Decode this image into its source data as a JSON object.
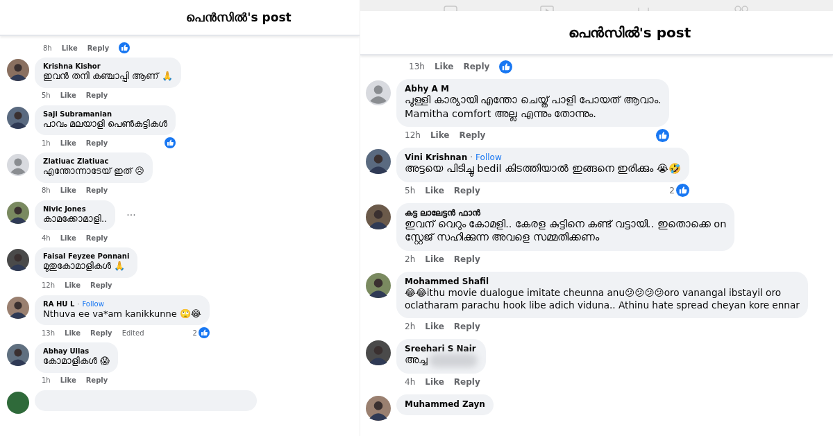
{
  "panels": [
    {
      "title": "പെൻസിൽ's post",
      "top_meta": {
        "time": "8h",
        "like": "Like",
        "reply": "Reply",
        "liked": true
      },
      "comments": [
        {
          "default_avatar": false,
          "name": "Krishna Kishor",
          "lines": [
            "ഇവൻ തനി കഞ്ചാപ്പി ആണ് 🙏"
          ],
          "time": "5h",
          "like": "Like",
          "reply": "Reply",
          "liked": false
        },
        {
          "default_avatar": false,
          "name": "Saji Subramanian",
          "lines": [
            "പാവം മലയാളി പെൺകുട്ടികൾ"
          ],
          "time": "1h",
          "like": "Like",
          "reply": "Reply",
          "liked": true
        },
        {
          "default_avatar": true,
          "name": "Zlatiuac Zlatiuac",
          "lines": [
            "എന്തോന്നാടേയ് ഇത് 😥"
          ],
          "time": "8h",
          "like": "Like",
          "reply": "Reply",
          "liked": false
        },
        {
          "default_avatar": false,
          "name": "Nivic Jones",
          "lines": [
            "കാമക്കോമാളി.."
          ],
          "more": "···",
          "time": "4h",
          "like": "Like",
          "reply": "Reply",
          "liked": false
        },
        {
          "default_avatar": false,
          "name": "Faisal Feyzee Ponnani",
          "lines": [
            "മുതുകോമാളികൾ 🙏"
          ],
          "time": "12h",
          "like": "Like",
          "reply": "Reply",
          "liked": false
        },
        {
          "default_avatar": false,
          "name": "RA HU L",
          "separator": "·",
          "follow": "Follow",
          "lines": [
            "Nthuva ee va*am kanikkunne 🙄😂"
          ],
          "time": "13h",
          "like": "Like",
          "reply": "Reply",
          "edited": "Edited",
          "reactions": "2",
          "liked": true
        },
        {
          "default_avatar": false,
          "name": "Abhay Ullas",
          "lines": [
            "കോമാളികൾ 😱"
          ],
          "time": "1h",
          "like": "Like",
          "reply": "Reply",
          "liked": false
        }
      ],
      "stub": true
    },
    {
      "title": "പെൻസിൽ's post",
      "toolbar": true,
      "top_meta": {
        "time": "13h",
        "like": "Like",
        "reply": "Reply",
        "liked": true
      },
      "comments": [
        {
          "default_avatar": true,
          "name": "Abhy A M",
          "lines": [
            "പുള്ളി കാര്യായി എന്തോ ചെയ്ത് പാളി പോയത് ആവാം.",
            "Mamitha comfort അല്ല എന്നും തോന്നും."
          ],
          "time": "12h",
          "like": "Like",
          "reply": "Reply",
          "liked": true
        },
        {
          "default_avatar": false,
          "name": "Vini Krishnan",
          "separator": "·",
          "follow": "Follow",
          "lines": [
            "അട്ടയെ പിടിച്ചു bedil കിടത്തിയാൽ ഇങ്ങനെ ഇരിക്കും 😭🤣"
          ],
          "time": "5h",
          "like": "Like",
          "reply": "Reply",
          "reactions": "2",
          "liked": true
        },
        {
          "default_avatar": false,
          "name": "കട്ട ലാലേട്ടൻ ഫാൻ",
          "lines": [
            "ഇവന് വെറും കോമളി.. കേരള കുട്ടിനെ കണ്ട് വട്ടായി.. ഇതൊക്കെ on",
            "സ്റ്റേജ് സഹിക്കുന്ന അവളെ സമ്മതിക്കണം"
          ],
          "time": "2h",
          "like": "Like",
          "reply": "Reply",
          "liked": false
        },
        {
          "default_avatar": false,
          "name": "Mohammed Shafil",
          "lines": [
            "😂😂ithu movie dualogue imitate cheunna anu😕😕😕😕oro vanangal ibstayil oro",
            "oclatharam parachu hook libe adich viduna.. Athinu hate spread cheyan kore ennar"
          ],
          "time": "2h",
          "like": "Like",
          "reply": "Reply",
          "liked": false
        },
        {
          "default_avatar": false,
          "name": "Sreehari S Nair",
          "lines": [
            "അച്ച"
          ],
          "blurred": true,
          "time": "4h",
          "like": "Like",
          "reply": "Reply",
          "liked": false
        },
        {
          "default_avatar": false,
          "name": "Muhammed Zayn"
        }
      ]
    }
  ]
}
